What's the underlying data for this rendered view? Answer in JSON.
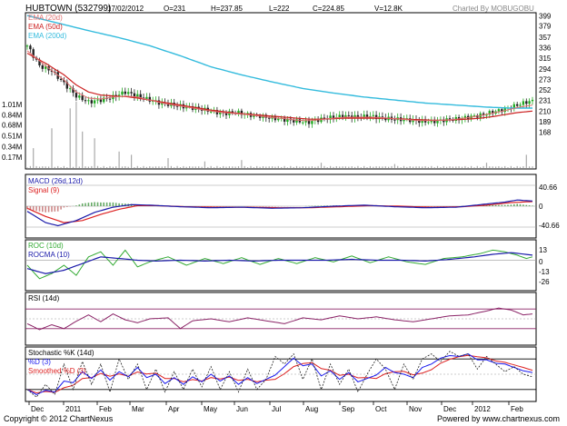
{
  "header": {
    "symbol": "HUBTOWN (532799)",
    "date": "17/02/2012",
    "open": "O=231",
    "high": "H=237.85",
    "low": "L=222",
    "close": "C=224.85",
    "volume": "V=12.8K",
    "credit": "Charted By MOBUGOBU"
  },
  "footer": {
    "copyright": "Copyright © 2012 ChartNexus",
    "powered": "Powered by www.chartnexus.com"
  },
  "colors": {
    "ema20": "#e07070",
    "ema50": "#cc2222",
    "ema200": "#33bbdd",
    "candle_up": "#22aa22",
    "candle_down": "#222222",
    "volume": "#aaaaaa",
    "macd": "#1a1aaa",
    "signal": "#dd2222",
    "macd_hist": "#cc8888",
    "roc": "#33aa33",
    "rocma": "#1a1aaa",
    "rsi": "#8a2266",
    "stoch_k": "#222222",
    "stoch_d": "#1a1aee",
    "stoch_sd": "#dd2222"
  },
  "chart_data": [
    {
      "type": "candlestick",
      "legend": [
        "EMA (20d)",
        "EMA (50d)",
        "EMA (200d)"
      ],
      "price_ticks": [
        399,
        379,
        357,
        336,
        315,
        294,
        273,
        252,
        231,
        210,
        189,
        168
      ],
      "volume_ticks": [
        "1.01M",
        "0.84M",
        "0.68M",
        "0.51M",
        "0.34M",
        "0.17M"
      ],
      "x_labels": [
        "Dec",
        "2011",
        "Feb",
        "Mar",
        "Apr",
        "May",
        "Jun",
        "Jul",
        "Aug",
        "Sep",
        "Oct",
        "Nov",
        "Dec",
        "2012",
        "Feb"
      ],
      "close_path": [
        [
          0,
          340
        ],
        [
          4,
          300
        ],
        [
          8,
          290
        ],
        [
          12,
          265
        ],
        [
          16,
          240
        ],
        [
          20,
          228
        ],
        [
          24,
          232
        ],
        [
          28,
          238
        ],
        [
          32,
          248
        ],
        [
          36,
          240
        ],
        [
          40,
          232
        ],
        [
          44,
          225
        ],
        [
          48,
          222
        ],
        [
          52,
          218
        ],
        [
          56,
          215
        ],
        [
          60,
          210
        ],
        [
          64,
          205
        ],
        [
          68,
          208
        ],
        [
          72,
          203
        ],
        [
          76,
          200
        ],
        [
          80,
          196
        ],
        [
          84,
          193
        ],
        [
          88,
          190
        ],
        [
          92,
          188
        ],
        [
          96,
          194
        ],
        [
          100,
          198
        ],
        [
          104,
          200
        ],
        [
          108,
          198
        ],
        [
          112,
          200
        ],
        [
          116,
          196
        ],
        [
          120,
          194
        ],
        [
          124,
          193
        ],
        [
          128,
          190
        ],
        [
          132,
          189
        ],
        [
          136,
          192
        ],
        [
          140,
          194
        ],
        [
          144,
          198
        ],
        [
          148,
          202
        ],
        [
          152,
          208
        ],
        [
          156,
          214
        ],
        [
          160,
          222
        ],
        [
          163,
          228
        ],
        [
          165,
          230
        ]
      ],
      "ema20": [
        [
          0,
          330
        ],
        [
          6,
          300
        ],
        [
          12,
          272
        ],
        [
          16,
          248
        ],
        [
          20,
          236
        ],
        [
          24,
          234
        ],
        [
          28,
          238
        ],
        [
          32,
          240
        ],
        [
          36,
          238
        ],
        [
          40,
          232
        ],
        [
          44,
          226
        ],
        [
          48,
          222
        ],
        [
          52,
          218
        ],
        [
          56,
          214
        ],
        [
          60,
          210
        ],
        [
          64,
          207
        ],
        [
          68,
          205
        ],
        [
          72,
          203
        ],
        [
          76,
          200
        ],
        [
          80,
          197
        ],
        [
          84,
          195
        ],
        [
          88,
          192
        ],
        [
          92,
          191
        ],
        [
          96,
          193
        ],
        [
          100,
          196
        ],
        [
          104,
          198
        ],
        [
          108,
          198
        ],
        [
          112,
          198
        ],
        [
          116,
          197
        ],
        [
          120,
          195
        ],
        [
          124,
          193
        ],
        [
          128,
          191
        ],
        [
          132,
          191
        ],
        [
          136,
          192
        ],
        [
          140,
          194
        ],
        [
          144,
          197
        ],
        [
          148,
          201
        ],
        [
          152,
          206
        ],
        [
          156,
          211
        ],
        [
          160,
          217
        ],
        [
          165,
          222
        ]
      ],
      "ema50": [
        [
          0,
          325
        ],
        [
          6,
          305
        ],
        [
          12,
          282
        ],
        [
          16,
          262
        ],
        [
          20,
          248
        ],
        [
          24,
          242
        ],
        [
          28,
          240
        ],
        [
          32,
          239
        ],
        [
          36,
          236
        ],
        [
          40,
          232
        ],
        [
          44,
          228
        ],
        [
          48,
          224
        ],
        [
          52,
          220
        ],
        [
          56,
          216
        ],
        [
          60,
          212
        ],
        [
          64,
          209
        ],
        [
          68,
          206
        ],
        [
          72,
          204
        ],
        [
          76,
          202
        ],
        [
          80,
          200
        ],
        [
          84,
          198
        ],
        [
          88,
          196
        ],
        [
          92,
          194
        ],
        [
          96,
          194
        ],
        [
          100,
          195
        ],
        [
          104,
          196
        ],
        [
          108,
          196
        ],
        [
          112,
          196
        ],
        [
          116,
          196
        ],
        [
          120,
          195
        ],
        [
          124,
          194
        ],
        [
          128,
          193
        ],
        [
          132,
          192
        ],
        [
          136,
          192
        ],
        [
          140,
          193
        ],
        [
          144,
          194
        ],
        [
          148,
          196
        ],
        [
          152,
          199
        ],
        [
          156,
          203
        ],
        [
          160,
          207
        ],
        [
          165,
          210
        ]
      ],
      "ema200": [
        [
          0,
          400
        ],
        [
          10,
          385
        ],
        [
          20,
          370
        ],
        [
          30,
          356
        ],
        [
          40,
          340
        ],
        [
          50,
          320
        ],
        [
          60,
          298
        ],
        [
          70,
          282
        ],
        [
          80,
          268
        ],
        [
          90,
          255
        ],
        [
          100,
          246
        ],
        [
          110,
          238
        ],
        [
          120,
          232
        ],
        [
          130,
          226
        ],
        [
          140,
          222
        ],
        [
          150,
          218
        ],
        [
          158,
          216
        ],
        [
          165,
          216
        ]
      ],
      "volume_spikes": [
        [
          2,
          0.3
        ],
        [
          8,
          0.6
        ],
        [
          14,
          0.9
        ],
        [
          16,
          1.0
        ],
        [
          18,
          0.55
        ],
        [
          22,
          0.45
        ],
        [
          30,
          0.25
        ],
        [
          34,
          0.2
        ],
        [
          46,
          0.15
        ],
        [
          58,
          0.1
        ],
        [
          70,
          0.12
        ],
        [
          96,
          0.08
        ],
        [
          120,
          0.06
        ],
        [
          150,
          0.08
        ],
        [
          163,
          0.2
        ]
      ]
    },
    {
      "type": "line",
      "legend": [
        "MACD (26d,12d)",
        "Signal (9)"
      ],
      "y_ticks": [
        "40.66",
        "0",
        "-40.66"
      ],
      "macd": [
        [
          0,
          -10
        ],
        [
          6,
          -32
        ],
        [
          10,
          -38
        ],
        [
          16,
          -28
        ],
        [
          22,
          -12
        ],
        [
          28,
          -2
        ],
        [
          34,
          3
        ],
        [
          40,
          2
        ],
        [
          50,
          -1
        ],
        [
          60,
          -3
        ],
        [
          70,
          -2
        ],
        [
          80,
          -4
        ],
        [
          90,
          -3
        ],
        [
          100,
          0
        ],
        [
          110,
          2
        ],
        [
          120,
          -1
        ],
        [
          130,
          -3
        ],
        [
          140,
          -2
        ],
        [
          148,
          3
        ],
        [
          156,
          8
        ],
        [
          160,
          12
        ],
        [
          165,
          10
        ]
      ],
      "signal": [
        [
          0,
          -4
        ],
        [
          6,
          -20
        ],
        [
          12,
          -32
        ],
        [
          18,
          -28
        ],
        [
          24,
          -16
        ],
        [
          30,
          -6
        ],
        [
          36,
          1
        ],
        [
          42,
          1
        ],
        [
          52,
          -1
        ],
        [
          62,
          -2
        ],
        [
          72,
          -2
        ],
        [
          82,
          -3
        ],
        [
          92,
          -3
        ],
        [
          102,
          -1
        ],
        [
          112,
          1
        ],
        [
          122,
          0
        ],
        [
          132,
          -2
        ],
        [
          142,
          -1
        ],
        [
          150,
          2
        ],
        [
          158,
          7
        ],
        [
          165,
          9
        ]
      ]
    },
    {
      "type": "line",
      "legend": [
        "ROC (10d)",
        "ROCMA (10)"
      ],
      "y_ticks": [
        "13",
        "0",
        "-13",
        "-26"
      ],
      "roc": [
        [
          0,
          -6
        ],
        [
          4,
          -22
        ],
        [
          8,
          -16
        ],
        [
          12,
          -6
        ],
        [
          16,
          -18
        ],
        [
          20,
          4
        ],
        [
          24,
          10
        ],
        [
          28,
          -6
        ],
        [
          32,
          12
        ],
        [
          36,
          -8
        ],
        [
          40,
          -2
        ],
        [
          46,
          4
        ],
        [
          52,
          -6
        ],
        [
          58,
          2
        ],
        [
          64,
          -4
        ],
        [
          70,
          3
        ],
        [
          76,
          -5
        ],
        [
          82,
          2
        ],
        [
          88,
          -4
        ],
        [
          94,
          3
        ],
        [
          100,
          -2
        ],
        [
          106,
          5
        ],
        [
          112,
          -3
        ],
        [
          118,
          4
        ],
        [
          124,
          -2
        ],
        [
          130,
          -5
        ],
        [
          136,
          2
        ],
        [
          142,
          4
        ],
        [
          148,
          8
        ],
        [
          152,
          12
        ],
        [
          156,
          10
        ],
        [
          160,
          6
        ],
        [
          163,
          2
        ],
        [
          165,
          4
        ]
      ],
      "rocma": [
        [
          0,
          -10
        ],
        [
          6,
          -16
        ],
        [
          12,
          -12
        ],
        [
          18,
          -4
        ],
        [
          24,
          4
        ],
        [
          30,
          2
        ],
        [
          36,
          0
        ],
        [
          42,
          -1
        ],
        [
          50,
          0
        ],
        [
          58,
          -1
        ],
        [
          66,
          0
        ],
        [
          74,
          -1
        ],
        [
          82,
          0
        ],
        [
          90,
          0
        ],
        [
          98,
          0
        ],
        [
          106,
          1
        ],
        [
          114,
          0
        ],
        [
          122,
          0
        ],
        [
          130,
          -1
        ],
        [
          138,
          1
        ],
        [
          146,
          4
        ],
        [
          152,
          7
        ],
        [
          158,
          9
        ],
        [
          165,
          6
        ]
      ]
    },
    {
      "type": "line",
      "legend": [
        "RSI (14d)"
      ],
      "rsi": [
        [
          0,
          40
        ],
        [
          4,
          28
        ],
        [
          8,
          38
        ],
        [
          12,
          30
        ],
        [
          16,
          45
        ],
        [
          20,
          58
        ],
        [
          24,
          44
        ],
        [
          28,
          60
        ],
        [
          32,
          48
        ],
        [
          36,
          42
        ],
        [
          40,
          50
        ],
        [
          46,
          52
        ],
        [
          50,
          30
        ],
        [
          54,
          46
        ],
        [
          60,
          50
        ],
        [
          66,
          44
        ],
        [
          72,
          52
        ],
        [
          78,
          46
        ],
        [
          84,
          40
        ],
        [
          90,
          52
        ],
        [
          96,
          48
        ],
        [
          102,
          56
        ],
        [
          108,
          50
        ],
        [
          114,
          54
        ],
        [
          120,
          48
        ],
        [
          126,
          44
        ],
        [
          132,
          50
        ],
        [
          138,
          56
        ],
        [
          144,
          58
        ],
        [
          150,
          66
        ],
        [
          154,
          72
        ],
        [
          158,
          68
        ],
        [
          162,
          58
        ],
        [
          165,
          60
        ]
      ]
    },
    {
      "type": "line",
      "legend": [
        "Stochastic %K (14d)",
        "%D (3)",
        "Smoothed %D (3)"
      ],
      "stoch_k": [
        [
          0,
          20
        ],
        [
          3,
          5
        ],
        [
          6,
          30
        ],
        [
          9,
          10
        ],
        [
          12,
          70
        ],
        [
          15,
          20
        ],
        [
          18,
          75
        ],
        [
          21,
          30
        ],
        [
          24,
          70
        ],
        [
          27,
          15
        ],
        [
          30,
          80
        ],
        [
          33,
          40
        ],
        [
          36,
          70
        ],
        [
          39,
          20
        ],
        [
          42,
          60
        ],
        [
          45,
          15
        ],
        [
          48,
          55
        ],
        [
          51,
          20
        ],
        [
          54,
          60
        ],
        [
          57,
          25
        ],
        [
          60,
          65
        ],
        [
          63,
          20
        ],
        [
          66,
          55
        ],
        [
          69,
          15
        ],
        [
          72,
          60
        ],
        [
          75,
          20
        ],
        [
          78,
          40
        ],
        [
          81,
          85
        ],
        [
          84,
          70
        ],
        [
          87,
          90
        ],
        [
          90,
          40
        ],
        [
          93,
          80
        ],
        [
          96,
          20
        ],
        [
          99,
          70
        ],
        [
          102,
          30
        ],
        [
          105,
          60
        ],
        [
          108,
          15
        ],
        [
          111,
          50
        ],
        [
          114,
          80
        ],
        [
          117,
          60
        ],
        [
          120,
          20
        ],
        [
          123,
          70
        ],
        [
          126,
          40
        ],
        [
          129,
          80
        ],
        [
          132,
          90
        ],
        [
          135,
          75
        ],
        [
          138,
          95
        ],
        [
          141,
          85
        ],
        [
          144,
          90
        ],
        [
          147,
          60
        ],
        [
          150,
          85
        ],
        [
          153,
          70
        ],
        [
          156,
          55
        ],
        [
          159,
          65
        ],
        [
          162,
          50
        ],
        [
          165,
          45
        ]
      ]
    }
  ]
}
